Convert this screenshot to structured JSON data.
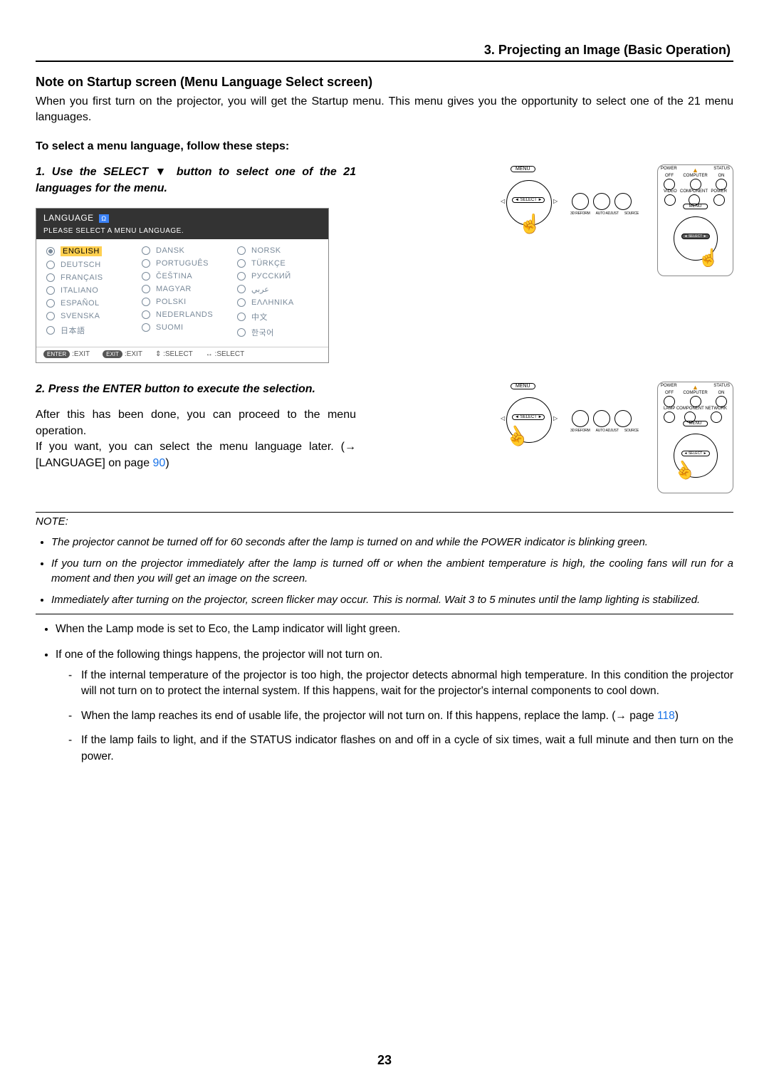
{
  "breadcrumb": "3. Projecting an Image (Basic Operation)",
  "heading1": "Note on Startup screen (Menu Language Select screen)",
  "intro": "When you first turn on the projector, you will get the Startup menu. This menu gives you the opportunity to select one of the 21 menu languages.",
  "stepsHeading": "To select a menu language, follow these steps:",
  "step1": "1.  Use the SELECT ▼ button to select one of the 21 languages for the menu.",
  "langPanel": {
    "title": "LANGUAGE",
    "subtitle": "PLEASE SELECT A MENU LANGUAGE.",
    "col1": [
      "ENGLISH",
      "DEUTSCH",
      "FRANÇAIS",
      "ITALIANO",
      "ESPAÑOL",
      "SVENSKA",
      "日本語"
    ],
    "col2": [
      "DANSK",
      "PORTUGUÊS",
      "ČEŠTINA",
      "MAGYAR",
      "POLSKI",
      "NEDERLANDS",
      "SUOMI"
    ],
    "col3": [
      "NORSK",
      "TÜRKÇE",
      "РУССКИЙ",
      "عربي",
      "ΕΛΛΗΝΙΚΑ",
      "中文",
      "한국어"
    ],
    "footer": {
      "enter": "ENTER",
      "enterTxt": ":EXIT",
      "exit": "EXIT",
      "exitTxt": ":EXIT",
      "ud": "⇕ :SELECT",
      "lr": "↔ :SELECT"
    }
  },
  "step2": "2.  Press the ENTER button to execute the selection.",
  "after1": "After this has been done, you can proceed to the menu operation.",
  "after2a": "If you want, you can select the menu language later. (→ [LANGUAGE] on page ",
  "pageLink1": "90",
  "after2b": ")",
  "noteLabel": "NOTE:",
  "note_items": [
    "The projector cannot be turned off for 60 seconds after the lamp is turned on and while the POWER indicator is blinking green.",
    "If you turn on the projector immediately after the lamp is turned off or when the ambient temperature is high, the cooling fans will run for a moment and then you will get an image on the screen.",
    "Immediately after turning on the projector, screen flicker may occur. This is normal. Wait 3 to 5 minutes until the lamp lighting is stabilized."
  ],
  "bullets2": [
    "When the Lamp mode is set to Eco, the Lamp indicator will light green.",
    "If one of the following things happens, the projector will not turn on."
  ],
  "bullets3": [
    {
      "t": "If the internal temperature of the projector is too high, the projector detects abnormal high temperature. In this condition the projector will not turn on to protect the internal system. If this happens, wait for the projector's internal components to cool down."
    },
    {
      "t1": "When the lamp reaches its end of usable life, the projector will not turn on. If this happens, replace the lamp. (→ page ",
      "link": "118",
      "t2": ")"
    },
    {
      "t": "If the lamp fails to light, and if the STATUS indicator flashes on and off in a cycle of six times, wait a full minute and then turn on the power."
    }
  ],
  "pageNum": "23",
  "panelLabels": {
    "menu": "MENU",
    "select": "SELECT",
    "mini": [
      "3D REFORM",
      "AUTO ADJUST",
      "SOURCE"
    ]
  },
  "remoteLabels": {
    "power": "POWER",
    "off": "OFF",
    "on": "ON",
    "status": "STATUS",
    "video": "VIDEO",
    "computer": "COMPUTER",
    "power2": "POWER",
    "lamp": "LAMP",
    "component": "COMPONENT",
    "network": "NETWORK",
    "menu": "MENU",
    "select": "SELECT"
  }
}
